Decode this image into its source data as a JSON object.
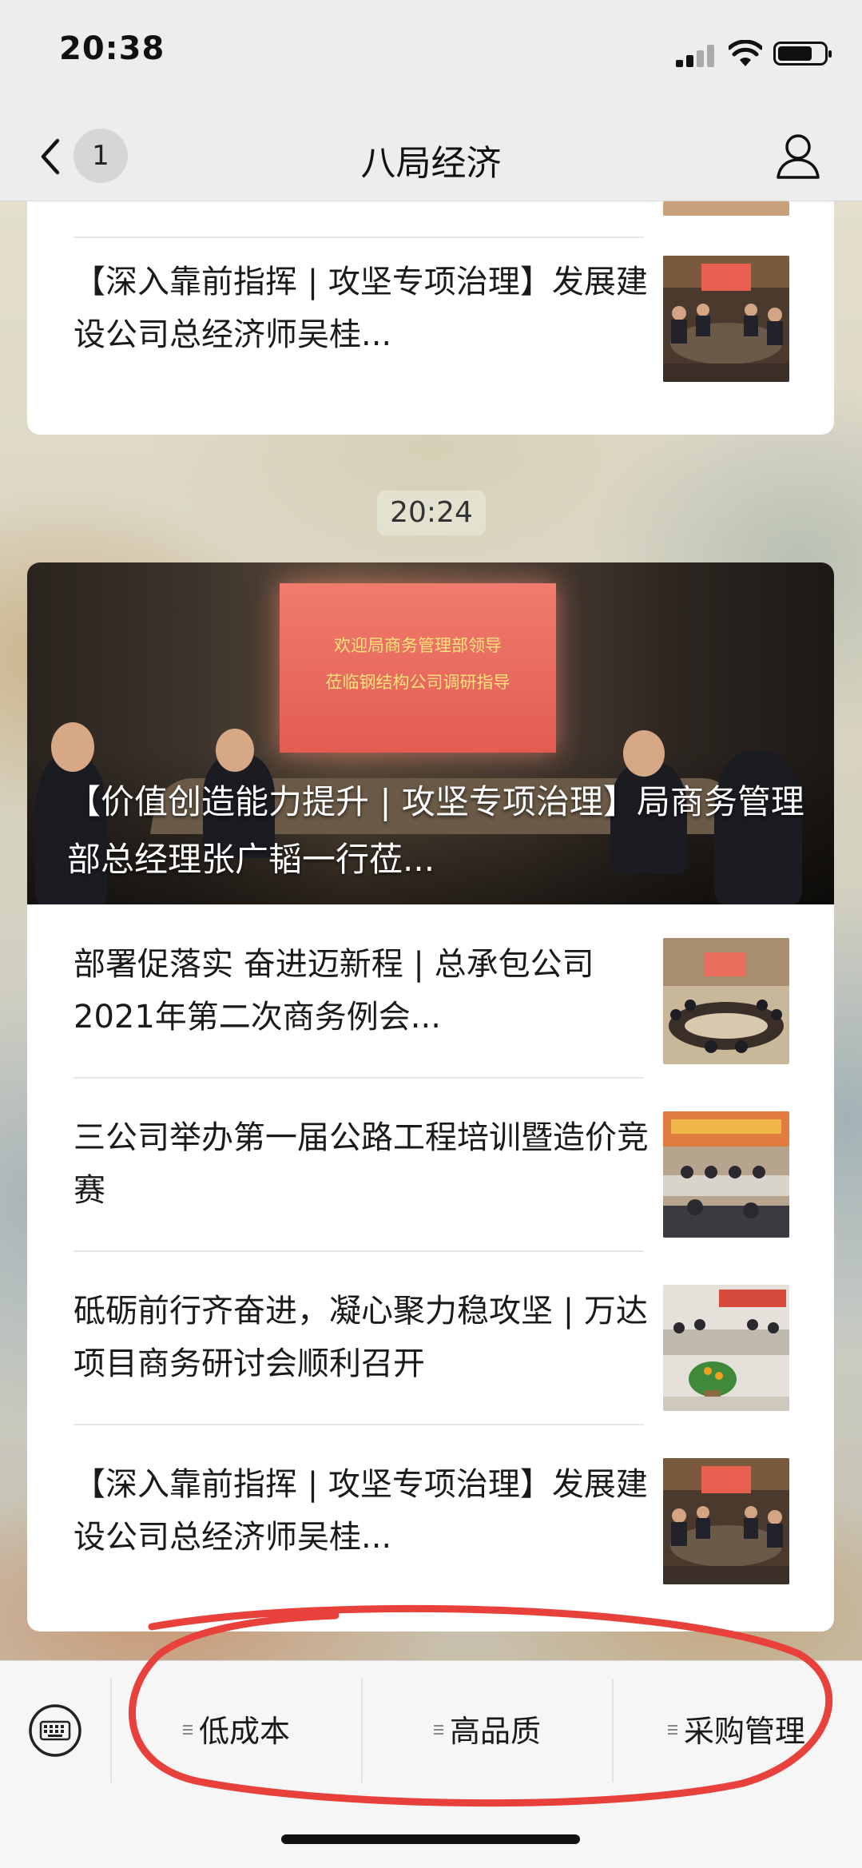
{
  "status_bar": {
    "time": "20:38",
    "battery_level": 0.75
  },
  "nav": {
    "back_badge": "1",
    "title": "八局经济"
  },
  "card_top": {
    "articles": [
      {
        "title": "【深入靠前指挥 | 攻坚专项治理】发展建设公司总经济师吴桂...",
        "thumb": "meeting-photo"
      }
    ]
  },
  "timestamp": "20:24",
  "card_main": {
    "hero": {
      "title": "【价值创造能力提升 | 攻坚专项治理】局商务管理部总经理张广韬一行莅...",
      "screen_line1": "欢迎局商务管理部领导",
      "screen_line2": "莅临钢结构公司调研指导"
    },
    "articles": [
      {
        "title": "部署促落实  奋进迈新程 | 总承包公司 2021年第二次商务例会...",
        "thumb": "meeting-photo"
      },
      {
        "title": "三公司举办第一届公路工程培训暨造价竞赛",
        "thumb": "meeting-photo"
      },
      {
        "title": "砥砺前行齐奋进，凝心聚力稳攻坚 | 万达项目商务研讨会顺利召开",
        "thumb": "meeting-photo"
      },
      {
        "title": "【深入靠前指挥 | 攻坚专项治理】发展建设公司总经济师吴桂...",
        "thumb": "meeting-photo"
      }
    ]
  },
  "menu": {
    "items": [
      {
        "label": "低成本"
      },
      {
        "label": "高品质"
      },
      {
        "label": "采购管理"
      }
    ],
    "annotation_color": "#e8403a"
  }
}
